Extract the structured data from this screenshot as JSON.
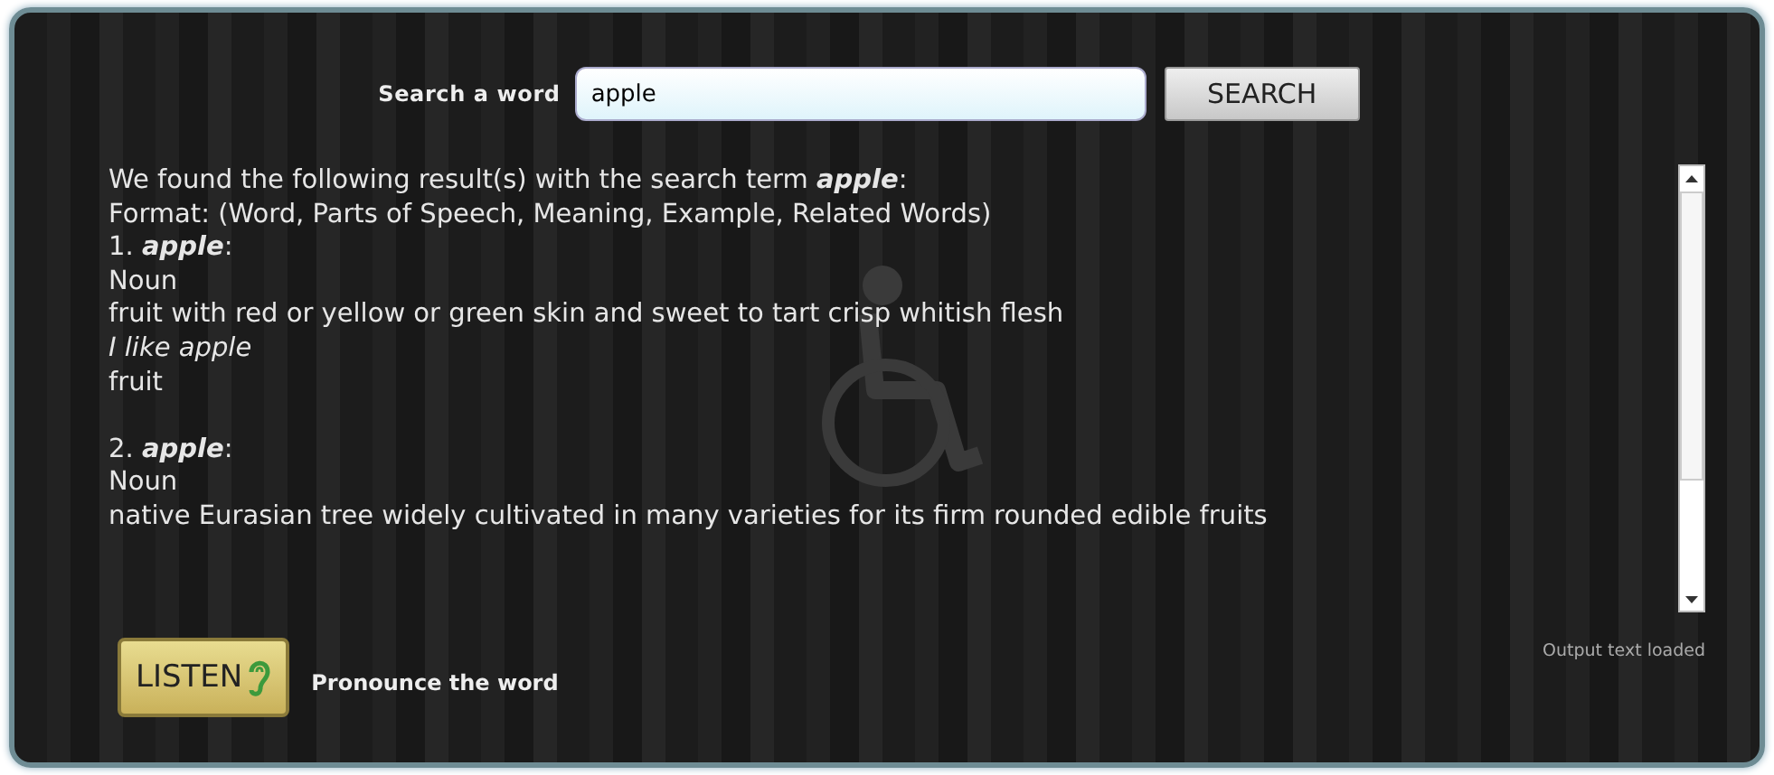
{
  "search": {
    "label": "Search a word",
    "value": "apple",
    "button": "SEARCH"
  },
  "results": {
    "intro": "We found the following result(s) with the search term  **apple**:",
    "format": "Format: (Word, Parts of Speech, Meaning, Example, Related Words)",
    "entries": [
      {
        "heading": "1. **apple**:",
        "pos": "Noun",
        "meaning": "fruit with red or yellow or green skin and sweet to tart crisp whitish flesh",
        "example": "I like apple",
        "related": "fruit"
      },
      {
        "heading": "2. **apple**:",
        "pos": "Noun",
        "meaning": "native Eurasian tree widely cultivated in many varieties for its firm rounded edible fruits"
      }
    ]
  },
  "listen": {
    "button": "LISTEN",
    "caption": "Pronounce the word"
  },
  "status": "Output text loaded"
}
